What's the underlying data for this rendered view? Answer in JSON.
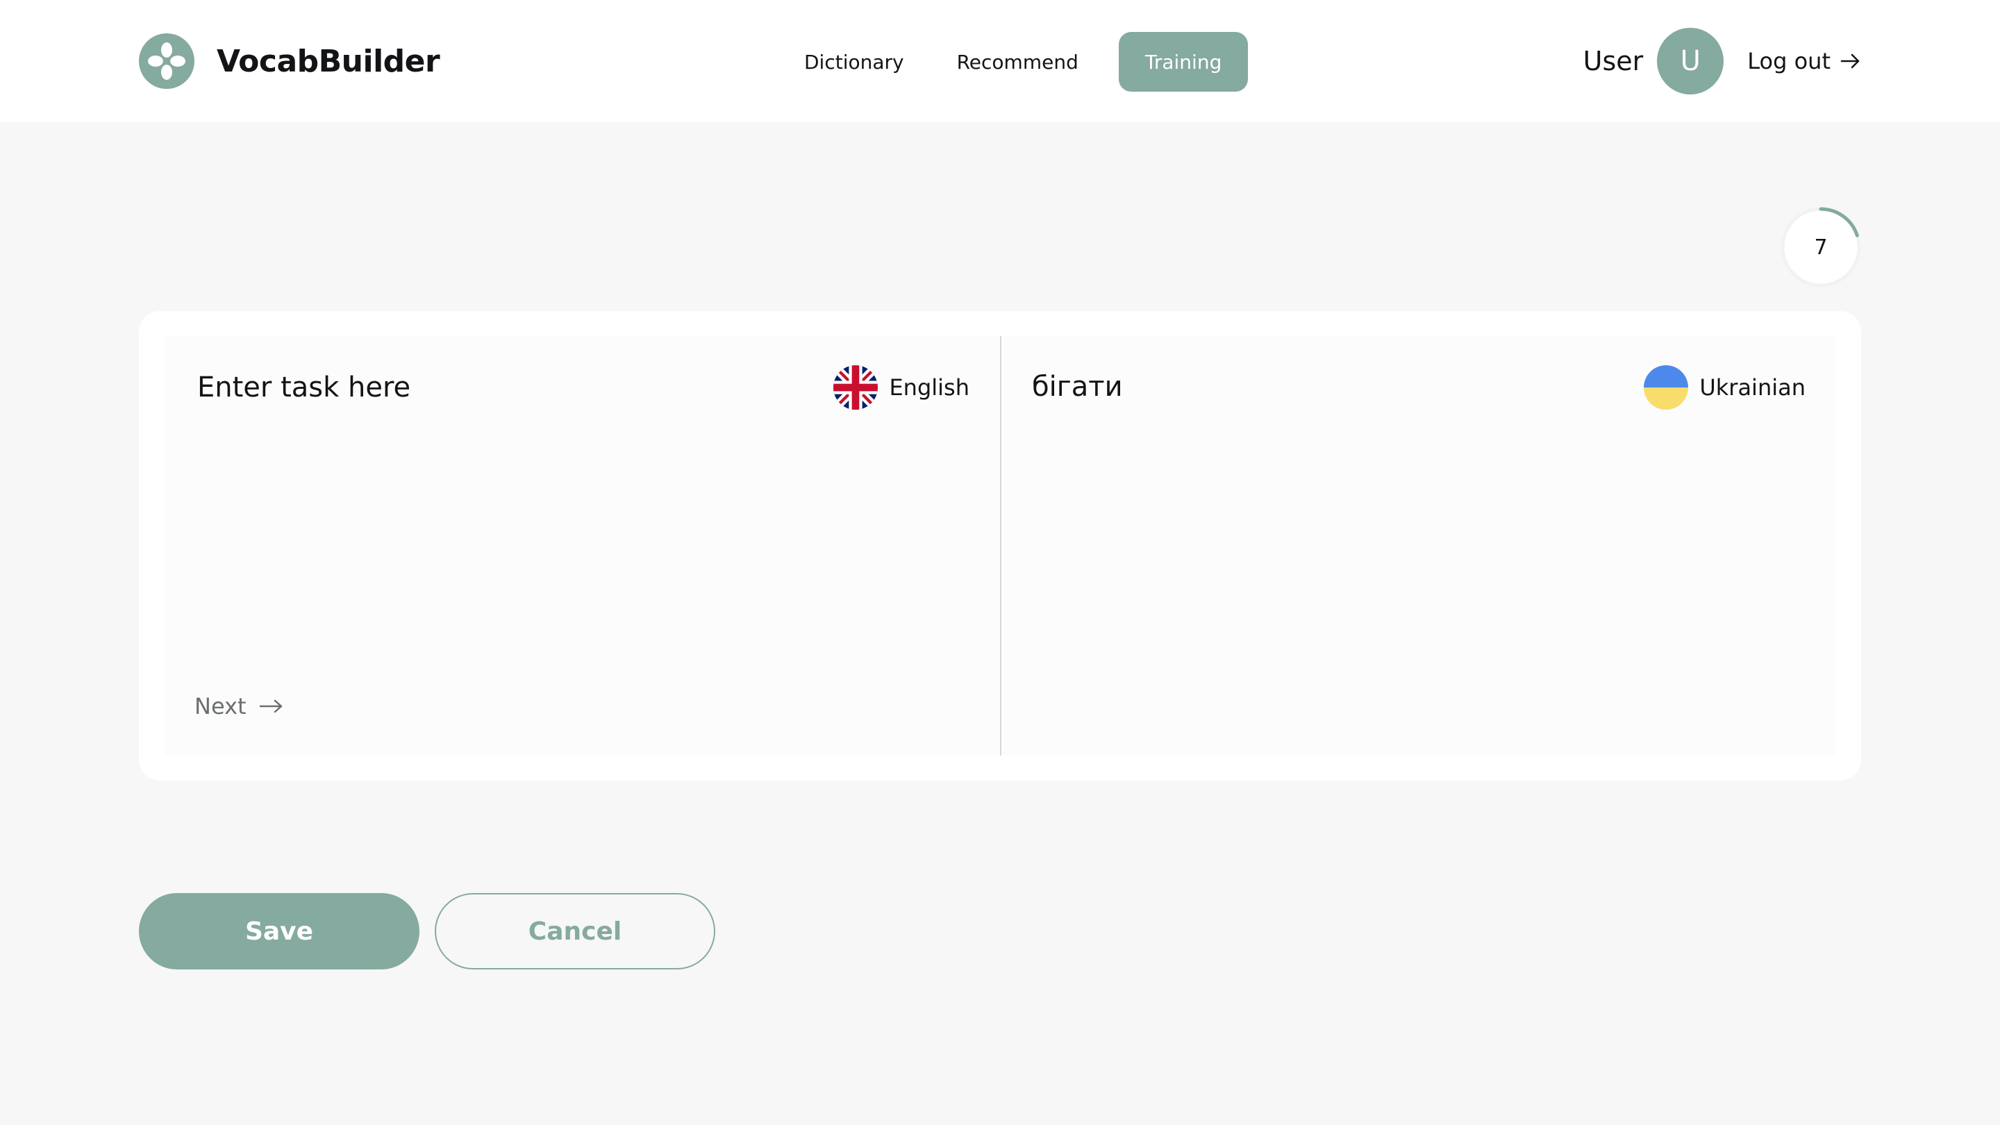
{
  "app": {
    "name": "VocabBuilder",
    "logo_icon": "clover-icon"
  },
  "nav": {
    "items": [
      {
        "label": "Dictionary",
        "active": false
      },
      {
        "label": "Recommend",
        "active": false
      },
      {
        "label": "Training",
        "active": true
      }
    ]
  },
  "user": {
    "name": "User",
    "avatar_initial": "U",
    "logout_label": "Log out",
    "logout_icon": "arrow-right-icon"
  },
  "training": {
    "progress_value": "7",
    "progress_fraction": 0.2,
    "source": {
      "placeholder": "Enter task here",
      "language": "English",
      "flag_icon": "uk-flag-icon"
    },
    "target": {
      "word": "бігати",
      "language": "Ukrainian",
      "flag_icon": "ukraine-flag-icon"
    },
    "next_label": "Next",
    "next_icon": "arrow-right-icon"
  },
  "actions": {
    "save_label": "Save",
    "cancel_label": "Cancel"
  },
  "colors": {
    "accent": "#85aa9f",
    "text": "#121417",
    "background": "#f7f7f7",
    "ukraine_blue": "#4c89eb",
    "ukraine_yellow": "#f8dc6c"
  }
}
